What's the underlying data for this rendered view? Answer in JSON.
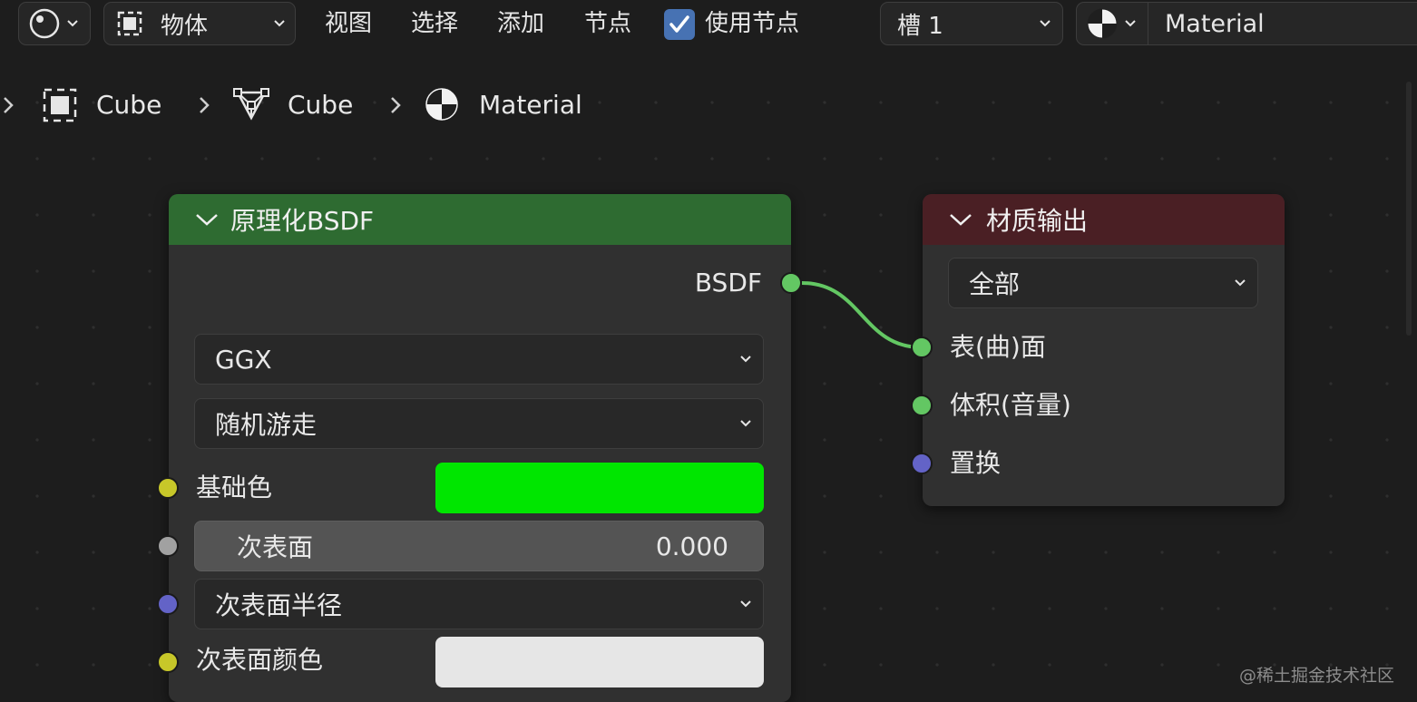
{
  "header": {
    "mode_label": "物体",
    "menus": [
      "视图",
      "选择",
      "添加",
      "节点"
    ],
    "use_nodes_label": "使用节点",
    "use_nodes_checked": true,
    "slot_label": "槽 1",
    "material_name": "Material"
  },
  "breadcrumb": {
    "items": [
      {
        "label": "Cube",
        "icon": "object-icon"
      },
      {
        "label": "Cube",
        "icon": "mesh-icon"
      },
      {
        "label": "Material",
        "icon": "material-icon"
      }
    ]
  },
  "bsdf_node": {
    "title": "原理化BSDF",
    "header_color": "#2e6b31",
    "output_label": "BSDF",
    "distribution": "GGX",
    "subsurface_method": "随机游走",
    "base_color_label": "基础色",
    "base_color": "#00e600",
    "subsurface_label": "次表面",
    "subsurface_value": "0.000",
    "subsurface_radius_label": "次表面半径",
    "subsurface_color_label": "次表面颜色",
    "subsurface_color": "#e6e6e6"
  },
  "output_node": {
    "title": "材质输出",
    "header_color": "#4a1f24",
    "target": "全部",
    "inputs": [
      "表(曲)面",
      "体积(音量)",
      "置换"
    ]
  },
  "colors": {
    "socket_shader": "#63c763",
    "socket_color": "#c7c729",
    "socket_float": "#a1a1a1",
    "socket_vector": "#6363c7",
    "link": "#63c763"
  },
  "watermark": "@稀土掘金技术社区"
}
